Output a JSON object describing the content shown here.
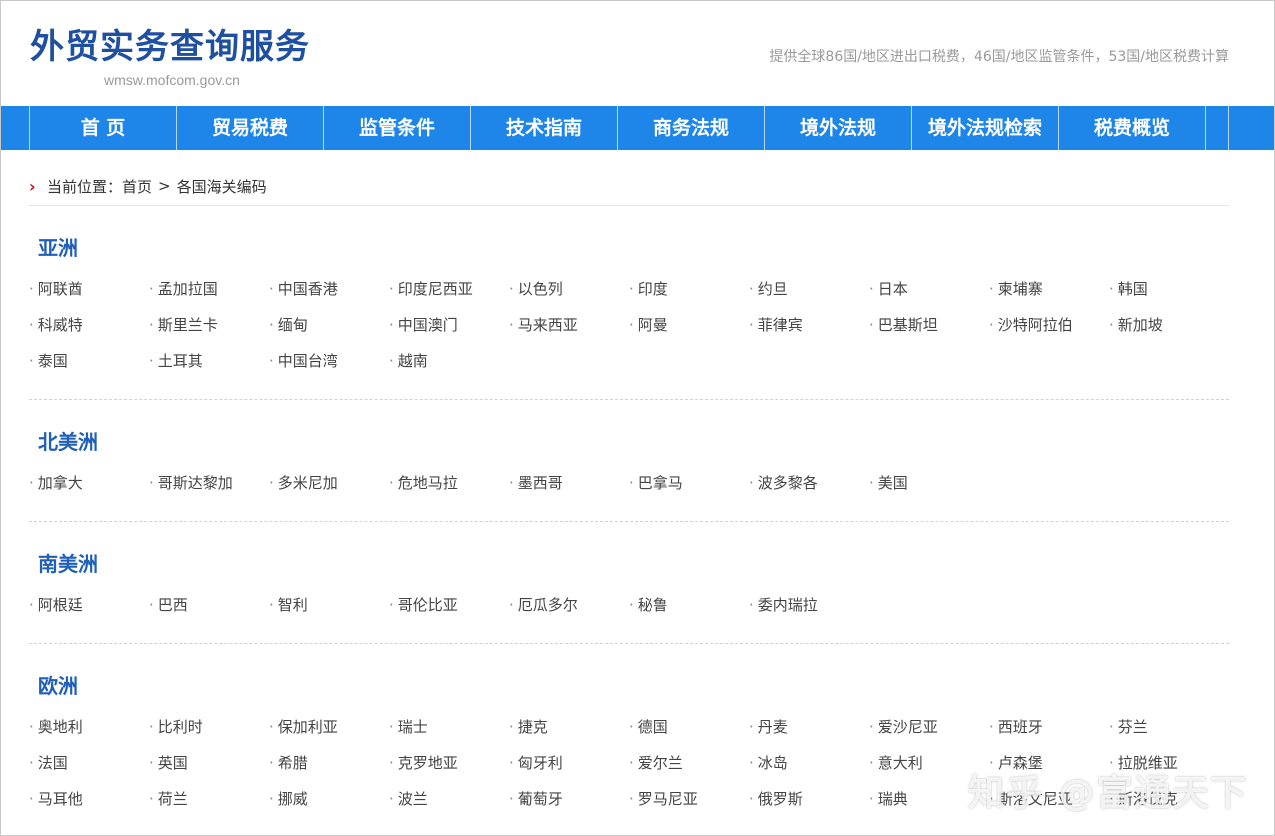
{
  "header": {
    "title": "外贸实务查询服务",
    "url": "wmsw.mofcom.gov.cn",
    "tagline": "提供全球86国/地区进出口税费，46国/地区监管条件，53国/地区税费计算"
  },
  "nav": {
    "items": [
      "首 页",
      "贸易税费",
      "监管条件",
      "技术指南",
      "商务法规",
      "境外法规",
      "境外法规检索",
      "税费概览"
    ]
  },
  "breadcrumb": {
    "prefix": "当前位置：",
    "home": "首页",
    "separator": ">",
    "current": "各国海关编码"
  },
  "regions": [
    {
      "name": "亚洲",
      "rows": [
        [
          "阿联酋",
          "孟加拉国",
          "中国香港",
          "印度尼西亚",
          "以色列",
          "印度",
          "约旦",
          "日本",
          "柬埔寨",
          "韩国"
        ],
        [
          "科威特",
          "斯里兰卡",
          "缅甸",
          "中国澳门",
          "马来西亚",
          "阿曼",
          "菲律宾",
          "巴基斯坦",
          "沙特阿拉伯",
          "新加坡"
        ],
        [
          "泰国",
          "土耳其",
          "中国台湾",
          "越南"
        ]
      ]
    },
    {
      "name": "北美洲",
      "rows": [
        [
          "加拿大",
          "哥斯达黎加",
          "多米尼加",
          "危地马拉",
          "墨西哥",
          "巴拿马",
          "波多黎各",
          "美国"
        ]
      ]
    },
    {
      "name": "南美洲",
      "rows": [
        [
          "阿根廷",
          "巴西",
          "智利",
          "哥伦比亚",
          "厄瓜多尔",
          "秘鲁",
          "委内瑞拉"
        ]
      ]
    },
    {
      "name": "欧洲",
      "rows": [
        [
          "奥地利",
          "比利时",
          "保加利亚",
          "瑞士",
          "捷克",
          "德国",
          "丹麦",
          "爱沙尼亚",
          "西班牙",
          "芬兰"
        ],
        [
          "法国",
          "英国",
          "希腊",
          "克罗地亚",
          "匈牙利",
          "爱尔兰",
          "冰岛",
          "意大利",
          "卢森堡",
          "拉脱维亚"
        ],
        [
          "马耳他",
          "荷兰",
          "挪威",
          "波兰",
          "葡萄牙",
          "罗马尼亚",
          "俄罗斯",
          "瑞典",
          "斯洛文尼亚",
          "斯洛伐克"
        ]
      ]
    }
  ],
  "bullet": "·",
  "watermark": "知乎 @富通天下",
  "colors": {
    "nav_bg": "#1e86e8",
    "title": "#1f4fa0",
    "region_title": "#1f5fb8",
    "breadcrumb_arrow": "#c0151b"
  },
  "icons": {
    "breadcrumb_marker": "chevron-right-icon"
  }
}
